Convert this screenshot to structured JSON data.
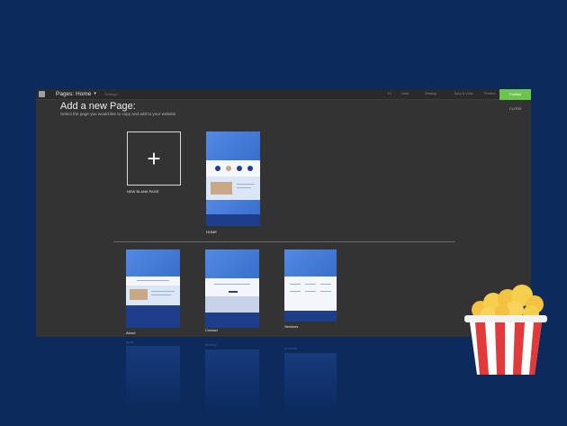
{
  "topbar": {
    "pages_label": "Pages: Home",
    "settings_label": "Settings",
    "items": [
      {
        "label": "Fx"
      },
      {
        "label": "Desk"
      },
      {
        "label": "Desktop"
      },
      {
        "label": "Back & Undo"
      },
      {
        "label": "Preview"
      }
    ],
    "publish_label": "Publish"
  },
  "dialog": {
    "title": "Add a new Page:",
    "subtitle": "Select the page you would like to copy and add to your website",
    "close_label": "CLOSE"
  },
  "templates": {
    "blank_label": "NEW BLANK PAGE",
    "home_label": "HOME",
    "pages": [
      {
        "label": "About"
      },
      {
        "label": "Contact"
      },
      {
        "label": "Services"
      }
    ]
  },
  "reflection_labels": [
    "gpos",
    "privacy",
    "process"
  ],
  "colors": {
    "background": "#0c2a5c",
    "app_bg": "#333333",
    "publish": "#6dc44c",
    "template_blue": "#3f78d4",
    "template_navy": "#1d3e8a"
  },
  "icons": {
    "plus": "+",
    "chevron": "▾"
  }
}
